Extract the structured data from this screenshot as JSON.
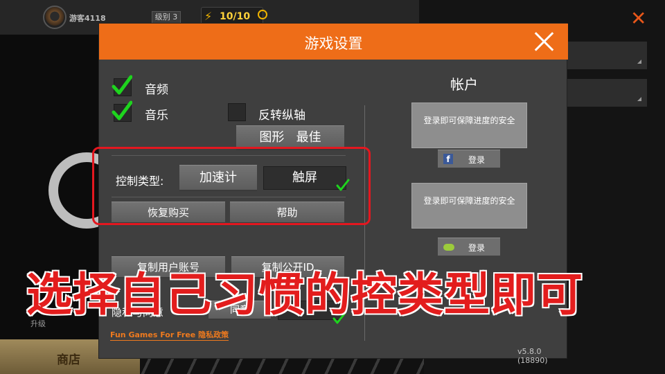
{
  "background": {
    "player_name": "游客4118",
    "level_label": "级别 3",
    "energy": "10/10",
    "upgrade_label": "升级",
    "shop_label": "商店",
    "close_glyph": "✕"
  },
  "dialog": {
    "title": "游戏设置",
    "options": {
      "audio_label": "音频",
      "audio_checked": true,
      "music_label": "音乐",
      "music_checked": true,
      "invert_axis_label": "反转纵轴",
      "invert_axis_checked": false,
      "graphics_label": "图形",
      "graphics_value": "最佳"
    },
    "controls": {
      "label": "控制类型:",
      "accelerometer": "加速计",
      "touchscreen": "触屏",
      "selected": "touchscreen"
    },
    "buttons": {
      "restore_purchase": "恢复购买",
      "help": "帮助",
      "copy_user_account": "复制用户账号",
      "copy_public_id": "复制公开ID",
      "privacy_consent": "隐私与同意",
      "agree": "同意"
    },
    "account": {
      "title": "帐户",
      "prompt_1": "登录即可保障进度的安全",
      "login_facebook": "登录",
      "prompt_2": "登录即可保障进度的安全",
      "login_gamecenter": "登录"
    },
    "footer_link": "Fun Games For Free 隐私政策",
    "version": "v5.8.0 (18890)"
  },
  "overlay": {
    "caption": "选择自己习惯的控类型即可"
  },
  "colors": {
    "header_orange": "#ee6d18",
    "check_green": "#1ed41e",
    "highlight_red": "#e4171f"
  }
}
